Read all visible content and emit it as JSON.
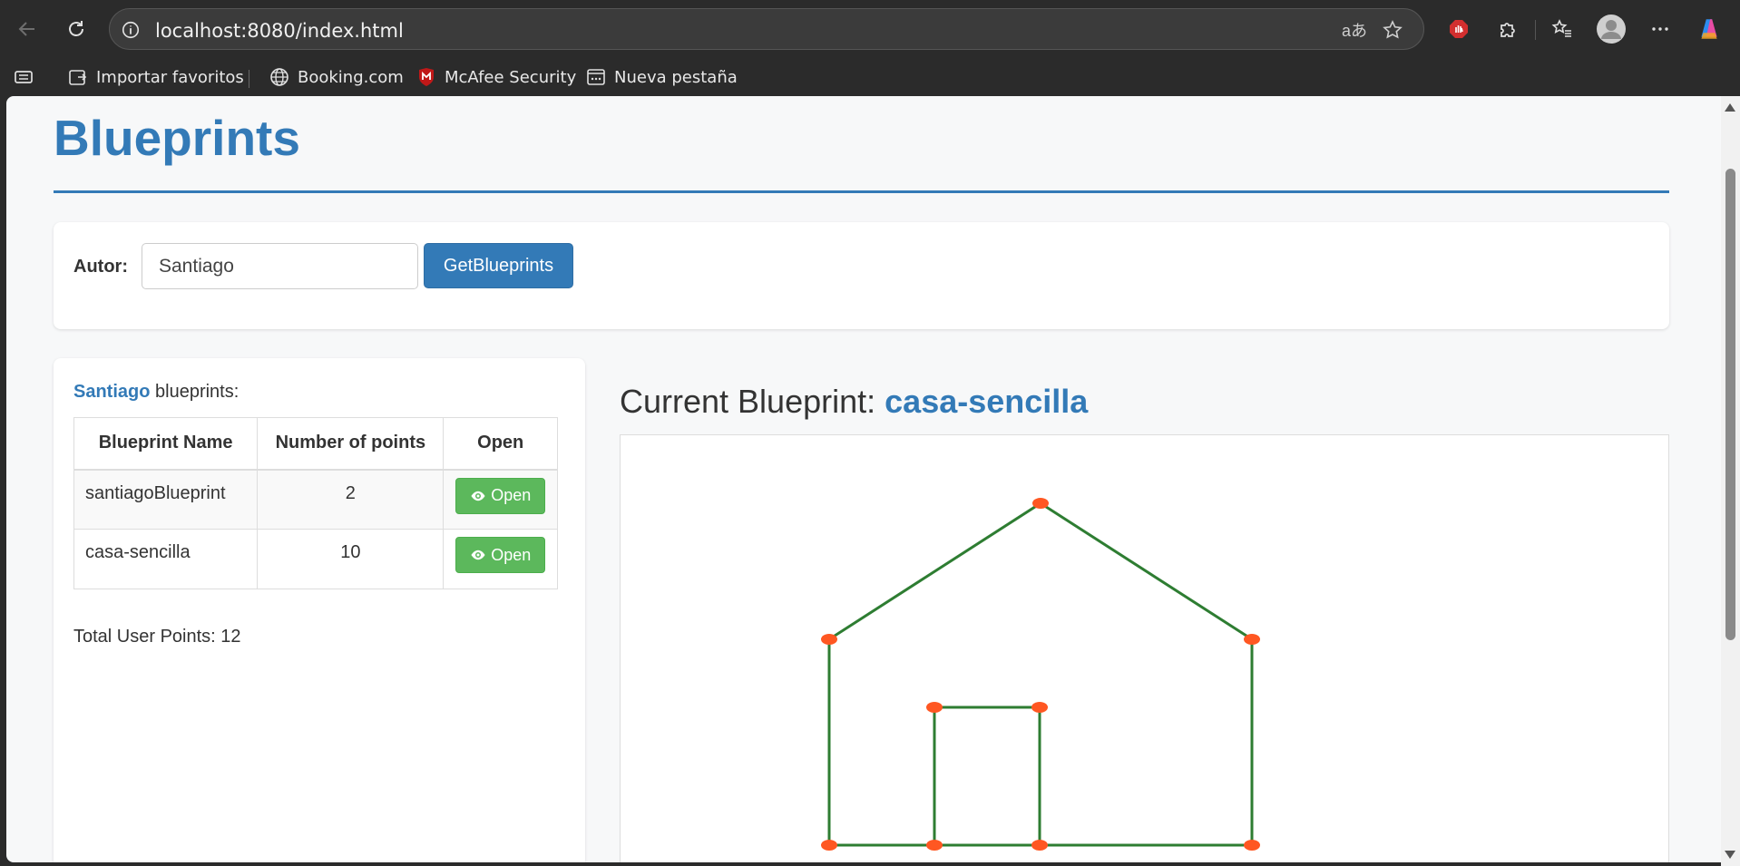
{
  "browser": {
    "url": "localhost:8080/index.html",
    "bookmarks": [
      {
        "label": "Importar favoritos",
        "icon": "import-favorites-icon"
      },
      {
        "label": "Booking.com",
        "icon": "globe-icon"
      },
      {
        "label": "McAfee Security",
        "icon": "mcafee-shield-icon"
      },
      {
        "label": "Nueva pestaña",
        "icon": "new-tab-icon"
      }
    ]
  },
  "page": {
    "title": "Blueprints",
    "author_label": "Autor:",
    "author_value": "Santiago",
    "get_button": "GetBlueprints"
  },
  "list": {
    "author_name": "Santiago",
    "heading_suffix": "blueprints:",
    "columns": [
      "Blueprint Name",
      "Number of points",
      "Open"
    ],
    "rows": [
      {
        "name": "santiagoBlueprint",
        "points": "2",
        "action": "Open"
      },
      {
        "name": "casa-sencilla",
        "points": "10",
        "action": "Open"
      }
    ],
    "total": "Total User Points: 12"
  },
  "current": {
    "label": "Current Blueprint:",
    "name": "casa-sencilla",
    "line_color": "#2e7d32",
    "point_color": "#ff5722"
  },
  "colors": {
    "primary": "#337ab7",
    "success": "#5cb85c"
  }
}
